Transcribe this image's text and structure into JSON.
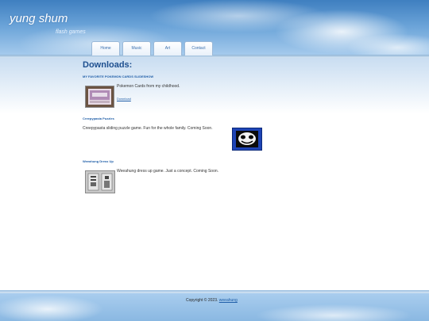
{
  "site": {
    "title": "yung shum",
    "subtitle": "flash games"
  },
  "nav": {
    "items": [
      {
        "label": "Home"
      },
      {
        "label": "Music"
      },
      {
        "label": "Art"
      },
      {
        "label": "Contact"
      }
    ]
  },
  "main": {
    "heading": "Downloads:",
    "items": [
      {
        "title": "MY FAVORITE POKEMON CARDS SLIDESHOW",
        "description": "Pokemon Cards from my childhood.",
        "link": "Download"
      },
      {
        "title": "Creepypasta Puzzles",
        "description": "Creepypasta sliding puzzle game. Fun for the whole family. Coming Soon."
      },
      {
        "title": "Weeahung Dress Up",
        "description": "Weeahung dress up game. Just a concept. Coming Soon."
      }
    ]
  },
  "footer": {
    "copyright": "Copyright © 2023.",
    "link": "weeahung"
  },
  "colors": {
    "accent": "#1f5ea8",
    "heading": "#1d4f8f",
    "sky": "#6aa3d8"
  }
}
